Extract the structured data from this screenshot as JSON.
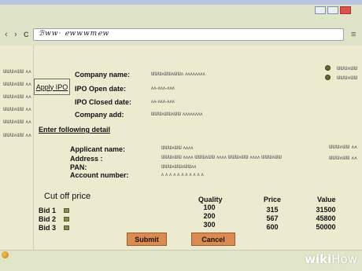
{
  "browser": {
    "address": "ℬww· ℯwwwmℯw",
    "back_icon": "‹",
    "forward_icon": "›",
    "refresh_icon": "C",
    "menu_icon": "≡"
  },
  "sidebar": {
    "items": [
      "ᗯᗯᗯᴧᗯᗯ ᴧᴧ",
      "ᗯᗯᗯᴧᗯᗯ ᴧᴧ",
      "ᗯᗯᗯᴧᗯᗯ ᴧᴧ",
      "ᗯᗯᗯᴧᗯᗯ ᴧᴧ",
      "ᗯᗯᗯᴧᗯᗯ ᴧᴧ",
      "ᗯᗯᗯᴧᗯᗯ ᴧᴧ"
    ],
    "apply_ipo": "Apply IPO"
  },
  "company": {
    "name_label": "Company name:",
    "name_value": "ᗯᗯᗯᴧᗯᗯᴧᗯᗯᴧ ᴧᴧᴧᴧᴧᴧᴧᴧ",
    "open_label": "IPO Open date:",
    "open_value": "ᴧᴧ-ᴧᴧᴧ-ᴧᴧᴧ",
    "closed_label": "IPO Closed date:",
    "closed_value": "ᴧᴧ-ᴧᴧᴧ-ᴧᴧᴧ",
    "add_label": "Company add:",
    "add_value": "ᗯᗯᗯᴧᗯᗯᴧᗯᗯ ᴧᴧᴧᴧᴧᴧᴧᴧ"
  },
  "radios": [
    "ᗯᗯᗯᴧᗯᗯ",
    "ᗯᗯᗯᴧᗯᗯ"
  ],
  "enter_detail": "Enter following detail",
  "applicant": {
    "name_label": "Applicant name:",
    "name_value": "ᗯᗯᗯᴧᗯᗯ ᴧᴧᴧᴧ",
    "address_label": "Address :",
    "address_value": "ᗯᗯᗯᴧᗯᗯ ᴧᴧᴧᴧ ᗯᗯᗯᴧᗯᗯ ᴧᴧᴧᴧ ᗯᗯᗯᴧᗯᗯ ᴧᴧᴧᴧ ᗯᗯᗯᴧᗯᗯ",
    "pan_label": "PAN:",
    "pan_value": "ᗯᗯᗯᴧᗯᗯᴧᗯᗯᴧᴧ",
    "account_label": "Account number:",
    "account_value": "ᴧ ᴧ ᴧ ᴧ  ᴧ ᴧ ᴧ ᴧ ᴧ  ᴧ ᴧ",
    "name_right": "ᗯᗯᗯᴧᗯᗯ ᴧᴧ",
    "address_right": "ᗯᗯᗯᴧᗯᗯ ᴧᴧ"
  },
  "bids": {
    "title": "Cut off price",
    "headers": {
      "quality": "Quality",
      "price": "Price",
      "value": "Value"
    },
    "rows": [
      {
        "label": "Bid 1",
        "quality": "100",
        "price": "315",
        "value": "31500"
      },
      {
        "label": "Bid 2",
        "quality": "200",
        "price": "567",
        "value": "45800"
      },
      {
        "label": "Bid 3",
        "quality": "300",
        "price": "600",
        "value": "50000"
      }
    ]
  },
  "buttons": {
    "submit": "Submit",
    "cancel": "Cancel"
  },
  "watermark": {
    "wiki": "wiki",
    "how": "How"
  },
  "colors": {
    "page_bg": "#ecebd0",
    "button_bg": "#d98b51",
    "radio": "#6b6a2e"
  }
}
